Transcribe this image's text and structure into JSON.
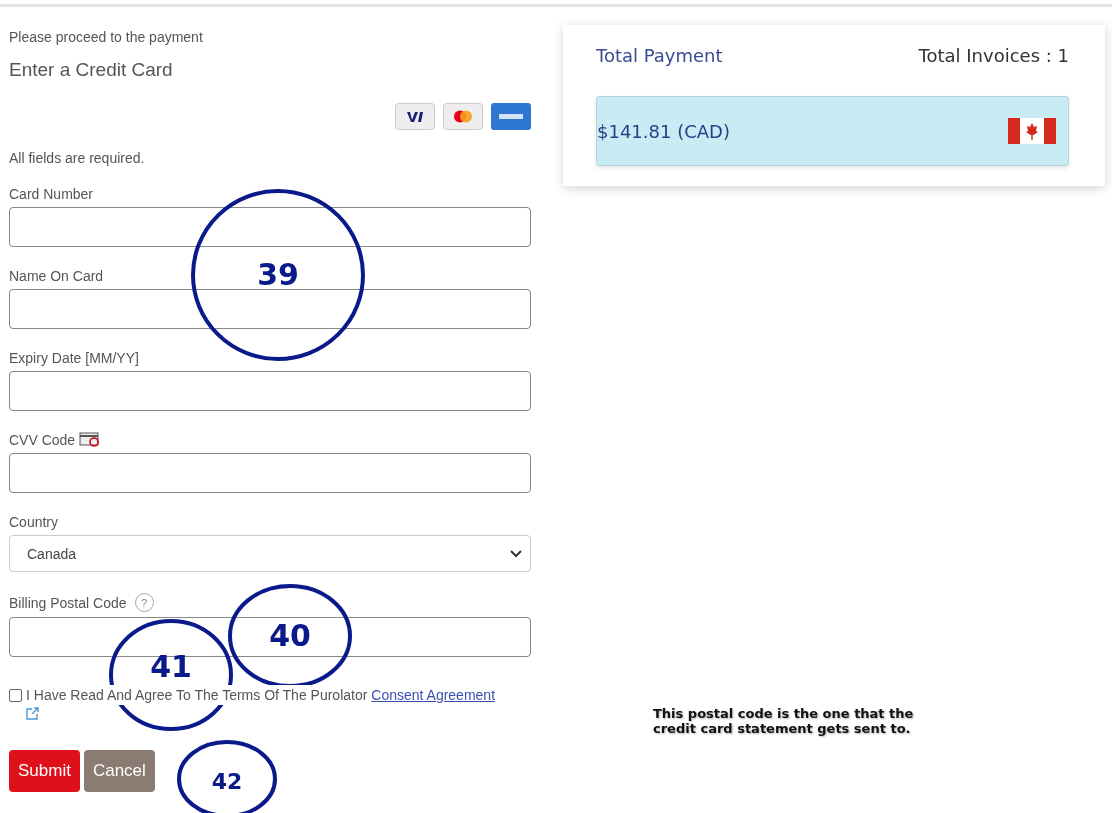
{
  "form": {
    "intro": "Please proceed to the payment",
    "title": "Enter a Credit Card",
    "note": "All fields are required.",
    "fields": [
      {
        "kind": "text",
        "label": "Card Number"
      },
      {
        "kind": "text",
        "label": "Name On Card"
      },
      {
        "kind": "text",
        "label": "Expiry Date [MM/YY]"
      },
      {
        "kind": "cvv",
        "label": "CVV Code"
      },
      {
        "kind": "select",
        "label": "Country",
        "value": "Canada"
      },
      {
        "kind": "help",
        "label": "Billing Postal Code",
        "help": "?"
      }
    ],
    "agreement": {
      "checked": false,
      "text": "I Have Read And Agree To The Terms Of The Purolator",
      "link": "Consent Agreement"
    },
    "buttons": [
      {
        "kind": "primary",
        "label": "Submit"
      },
      {
        "kind": "secondary",
        "label": "Cancel"
      }
    ]
  },
  "summary": {
    "title": "Total Payment",
    "invoices": "Total Invoices : 1",
    "amount": "$141.81 (CAD)"
  },
  "annotations": [
    {
      "label": "39"
    },
    {
      "label": "40"
    },
    {
      "label": "41"
    },
    {
      "label": "42"
    }
  ],
  "callout": "This postal code is the one that the credit card statement gets sent to."
}
